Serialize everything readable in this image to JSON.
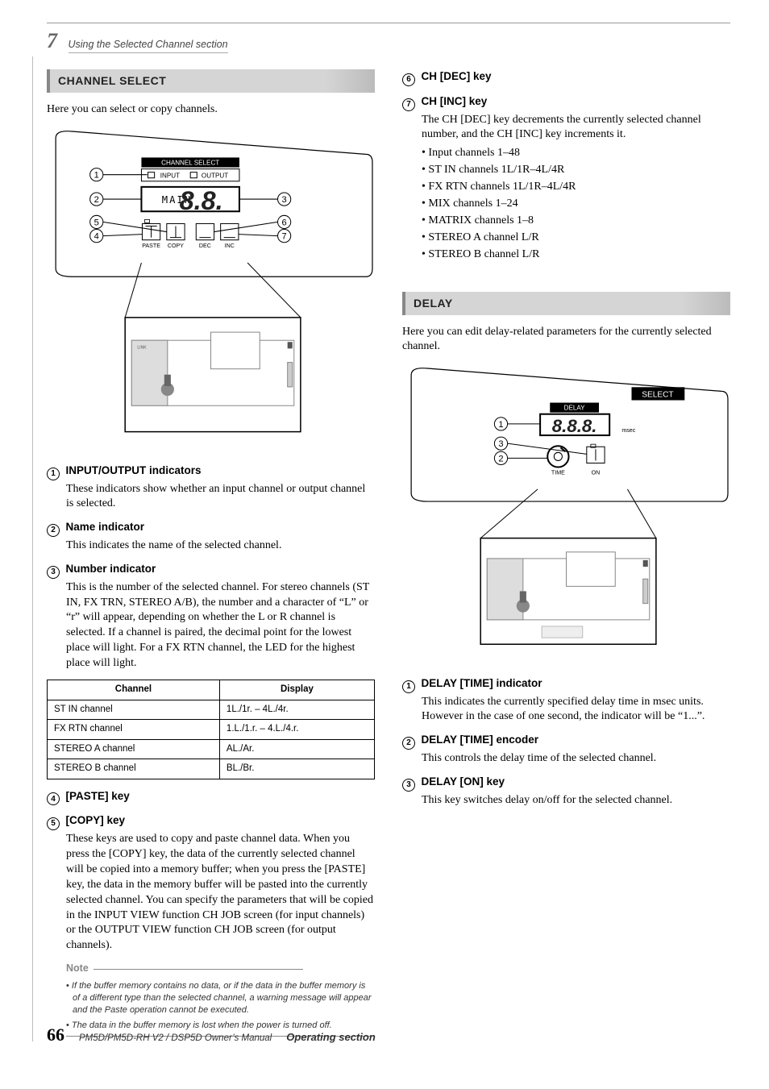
{
  "header": {
    "chapter_num": "7",
    "chapter_title": "Using the Selected Channel section"
  },
  "left": {
    "section1": {
      "heading": "CHANNEL SELECT",
      "intro": "Here you can select or copy channels.",
      "diagram": {
        "callouts": [
          "1",
          "2",
          "3",
          "4",
          "5",
          "6",
          "7"
        ],
        "labels": {
          "top": "CHANNEL SELECT",
          "input": "INPUT",
          "output": "OUTPUT",
          "main": "MAIN",
          "paste": "PASTE",
          "copy": "COPY",
          "dec": "DEC",
          "inc": "INC"
        }
      },
      "items": [
        {
          "n": "1",
          "title": "INPUT/OUTPUT indicators",
          "body": [
            "These indicators show whether an input channel or output channel is selected."
          ]
        },
        {
          "n": "2",
          "title": "Name indicator",
          "body": [
            "This indicates the name of the selected channel."
          ]
        },
        {
          "n": "3",
          "title": "Number indicator",
          "body": [
            "This is the number of the selected channel. For stereo channels (ST IN, FX TRN, STEREO A/B), the number and a character of “L” or “r” will appear, depending on whether the L or R channel is selected. If a channel is paired, the decimal point for the lowest place will light. For a FX RTN channel, the LED for the highest place will light."
          ]
        }
      ],
      "table": {
        "headers": [
          "Channel",
          "Display"
        ],
        "rows": [
          [
            "ST IN channel",
            "1L./1r. – 4L./4r."
          ],
          [
            "FX RTN channel",
            "1.L./1.r. – 4.L./4.r."
          ],
          [
            "STEREO A channel",
            "AL./Ar."
          ],
          [
            "STEREO B channel",
            "BL./Br."
          ]
        ]
      },
      "items2": [
        {
          "n": "4",
          "title": "[PASTE] key",
          "body": []
        },
        {
          "n": "5",
          "title": "[COPY] key",
          "body": [
            "These keys are used to copy and paste channel data. When you press the [COPY] key, the data of the currently selected channel will be copied into a memory buffer; when you press the [PASTE] key, the data in the memory buffer will be pasted into the currently selected channel. You can specify the parameters that will be copied in the INPUT VIEW function CH JOB screen (for input channels) or the OUTPUT VIEW function CH JOB screen (for output channels)."
          ]
        }
      ],
      "note": {
        "label": "Note",
        "bullets": [
          "If the buffer memory contains no data, or if the data in the buffer memory is of a different type than the selected channel, a warning message will appear and the Paste operation cannot be executed.",
          "The data in the buffer memory is lost when the power is turned off."
        ]
      }
    }
  },
  "right": {
    "items_top": [
      {
        "n": "6",
        "title": "CH [DEC] key",
        "body": []
      },
      {
        "n": "7",
        "title": "CH [INC] key",
        "body": [
          "The CH [DEC] key decrements the currently selected channel number, and the CH [INC] key increments it."
        ],
        "bullets": [
          "Input channels 1–48",
          "ST IN channels 1L/1R–4L/4R",
          "FX RTN channels 1L/1R–4L/4R",
          "MIX channels 1–24",
          "MATRIX channels 1–8",
          "STEREO A channel L/R",
          "STEREO B channel L/R"
        ]
      }
    ],
    "section2": {
      "heading": "DELAY",
      "intro": "Here you can edit delay-related parameters for the currently selected channel.",
      "diagram": {
        "callouts": [
          "1",
          "2",
          "3"
        ],
        "labels": {
          "boxtop": "SELECT",
          "top": "DELAY",
          "msec": "msec",
          "time": "TIME",
          "on": "ON",
          "digits": "8.8.8."
        }
      },
      "items": [
        {
          "n": "1",
          "title": "DELAY [TIME] indicator",
          "body": [
            "This indicates the currently specified delay time in msec units. However in the case of one second, the indicator will be “1...”."
          ]
        },
        {
          "n": "2",
          "title": "DELAY [TIME] encoder",
          "body": [
            "This controls the delay time of the selected channel."
          ]
        },
        {
          "n": "3",
          "title": "DELAY [ON] key",
          "body": [
            "This key switches delay on/off for the selected channel."
          ]
        }
      ]
    }
  },
  "footer": {
    "page": "66",
    "doc": "PM5D/PM5D-RH V2 / DSP5D Owner’s Manual",
    "section": "Operating section"
  }
}
